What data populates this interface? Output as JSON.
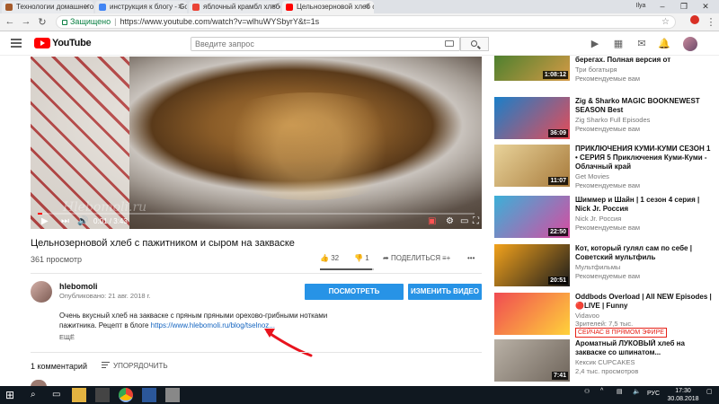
{
  "browser": {
    "tabs": [
      {
        "label": "Технологии домашнего",
        "favicon_color": "#a55a2a"
      },
      {
        "label": "инструкция к блогу - Go",
        "favicon_color": "#4285f4"
      },
      {
        "label": "яблочный крамбл хлебо",
        "favicon_color": "#ea4335"
      },
      {
        "label": "Цельнозерновой хлеб с",
        "favicon_color": "#ff0000"
      }
    ],
    "window_user": "Ilya",
    "secure_label": "Защищено",
    "url": "https://www.youtube.com/watch?v=wlhuWYSbyrY&t=1s"
  },
  "youtube": {
    "logo_text": "YouTube",
    "search_placeholder": "Введите запрос"
  },
  "player": {
    "watermark": "Hlebomoli.ru",
    "time": "0:01 / 3:43",
    "progress_fraction": 0.01
  },
  "video": {
    "title": "Цельнозерновой хлеб с пажитником и сыром на закваске",
    "views": "361 просмотр",
    "likes": "32",
    "dislikes": "1",
    "share_label": "ПОДЕЛИТЬСЯ",
    "more_label": "•••",
    "like_fraction": 0.97
  },
  "channel": {
    "name": "hlebomoli",
    "published": "Опубликовано: 21 авг. 2018 г.",
    "stats_button": "ПОСМОТРЕТЬ СТАТИСТИКУ",
    "edit_button": "ИЗМЕНИТЬ ВИДЕО"
  },
  "description": {
    "text": "Очень вкусный хлеб на закваске с пряным пряными орехово-грибными нотками пажитника. Рецепт в блоге",
    "link": "https://www.hlebomoli.ru/blog/tselnoz...",
    "more": "ЕЩЁ"
  },
  "comments": {
    "count_label": "1 комментарий",
    "sort_label": "УПОРЯДОЧИТЬ"
  },
  "sidebar": {
    "items": [
      {
        "title": "берегах. Полная версия от",
        "channel": "Три богатыря",
        "meta": "Рекомендуемые вам",
        "duration": "1:08:12",
        "colors": [
          "#3d7d2c",
          "#d59a45"
        ]
      },
      {
        "title": "Zig & Sharko MAGIC BOOKNEWEST SEASON Best",
        "channel": "Zig Sharko Full Episodes",
        "meta": "Рекомендуемые вам",
        "duration": "36:09",
        "colors": [
          "#1a7fc9",
          "#e84b56"
        ]
      },
      {
        "title": "ПРИКЛЮЧЕНИЯ КУМИ-КУМИ  СЕЗОН 1 • СЕРИЯ 5 Приключения Куми-Куми - Облачный край",
        "channel": "Get Movies",
        "meta": "Рекомендуемые вам",
        "duration": "11:07",
        "colors": [
          "#e9d39a",
          "#a77a3b"
        ]
      },
      {
        "title": "Шиммер и Шайн | 1 сезон 4 серия | Nick Jr. Россия",
        "channel": "Nick Jr. Россия",
        "meta": "Рекомендуемые вам",
        "duration": "22:50",
        "colors": [
          "#3bb0d8",
          "#d84ba0"
        ]
      },
      {
        "title": "Кот, который гулял сам по себе | Советский мультфиль",
        "channel": "Мультфильмы",
        "meta": "Рекомендуемые вам",
        "duration": "20:51",
        "colors": [
          "#f2a21c",
          "#1c1c1c"
        ]
      },
      {
        "title": "Oddbods Overload | All NEW Episodes | 🔴LIVE | Funny",
        "channel": "Vidavoo",
        "meta": "Зрителей: 7,5 тыс.",
        "live": "СЕЙЧАС В ПРЯМОМ ЭФИРЕ",
        "colors": [
          "#f04b52",
          "#ffd23a"
        ]
      },
      {
        "title": "Ароматный ЛУКОВЫЙ хлеб на закваске со шпинатом...",
        "channel": "Кексик CUPCAKES",
        "meta": "2,4 тыс. просмотров",
        "duration": "7:41",
        "colors": [
          "#b9b1a6",
          "#6f655b"
        ]
      }
    ]
  },
  "taskbar": {
    "time": "17:30",
    "date": "30.08.2018",
    "lang": "РУС"
  }
}
